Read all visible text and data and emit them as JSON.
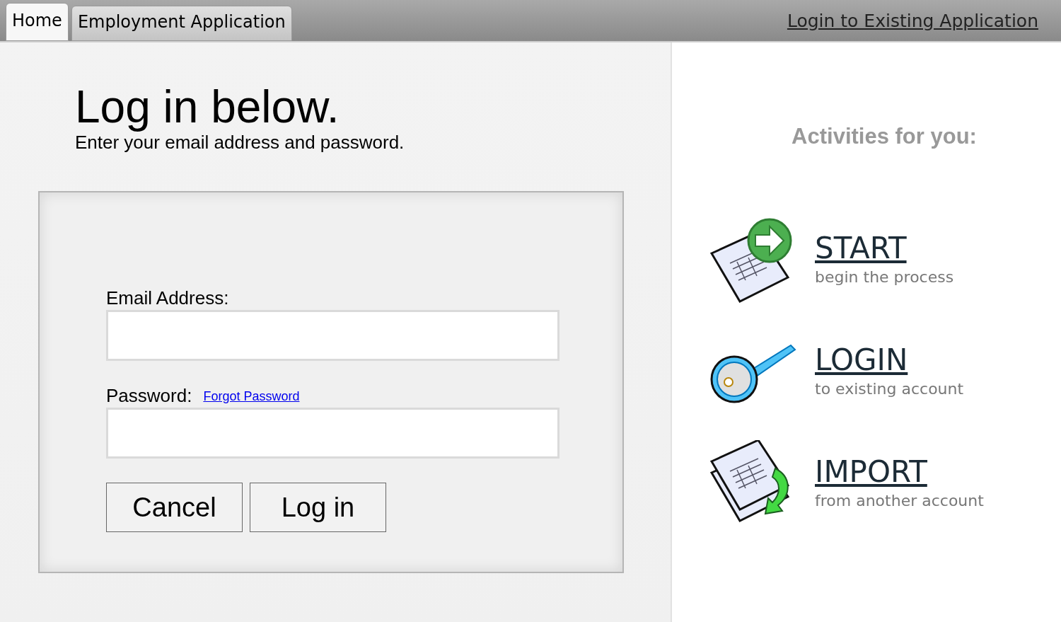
{
  "tabs": [
    {
      "label": "Home",
      "selected": true
    },
    {
      "label": "Employment Application",
      "selected": false
    }
  ],
  "header_link": "Login to Existing Application",
  "login": {
    "title": "Log in below.",
    "subtitle": "Enter your email address and password.",
    "email": {
      "label": "Email Address:"
    },
    "password": {
      "label": "Password:",
      "link": "Forgot Password"
    },
    "buttons": [
      "Cancel",
      "Log in"
    ]
  },
  "activities": {
    "title": "Activities for you:",
    "items": [
      {
        "kind": "start",
        "title": "START",
        "subtitle": "begin the process"
      },
      {
        "kind": "login",
        "title": "LOGIN",
        "subtitle": "to existing account"
      },
      {
        "kind": "import",
        "title": "IMPORT",
        "subtitle": "from another account"
      }
    ]
  }
}
